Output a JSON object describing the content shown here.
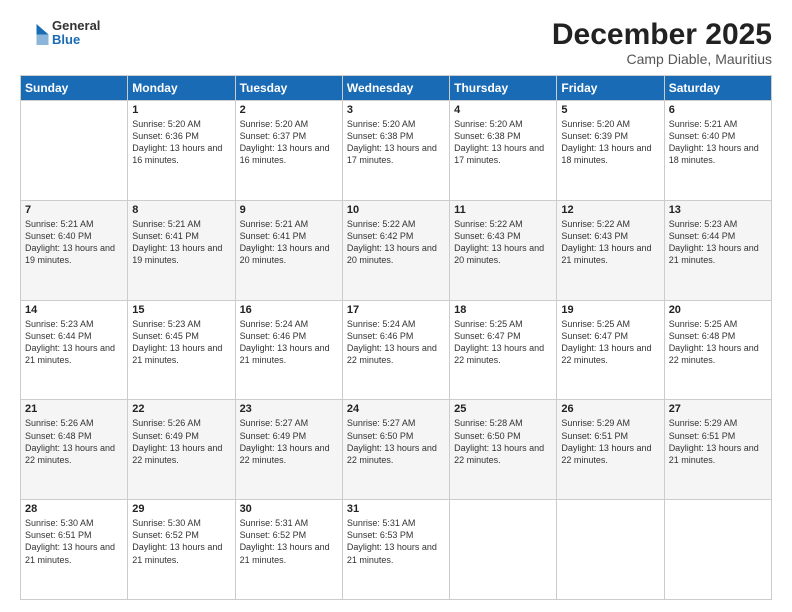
{
  "header": {
    "logo_general": "General",
    "logo_blue": "Blue",
    "title": "December 2025",
    "location": "Camp Diable, Mauritius"
  },
  "days_of_week": [
    "Sunday",
    "Monday",
    "Tuesday",
    "Wednesday",
    "Thursday",
    "Friday",
    "Saturday"
  ],
  "weeks": [
    [
      {
        "day": "",
        "info": ""
      },
      {
        "day": "1",
        "info": "Sunrise: 5:20 AM\nSunset: 6:36 PM\nDaylight: 13 hours and 16 minutes."
      },
      {
        "day": "2",
        "info": "Sunrise: 5:20 AM\nSunset: 6:37 PM\nDaylight: 13 hours and 16 minutes."
      },
      {
        "day": "3",
        "info": "Sunrise: 5:20 AM\nSunset: 6:38 PM\nDaylight: 13 hours and 17 minutes."
      },
      {
        "day": "4",
        "info": "Sunrise: 5:20 AM\nSunset: 6:38 PM\nDaylight: 13 hours and 17 minutes."
      },
      {
        "day": "5",
        "info": "Sunrise: 5:20 AM\nSunset: 6:39 PM\nDaylight: 13 hours and 18 minutes."
      },
      {
        "day": "6",
        "info": "Sunrise: 5:21 AM\nSunset: 6:40 PM\nDaylight: 13 hours and 18 minutes."
      }
    ],
    [
      {
        "day": "7",
        "info": "Sunrise: 5:21 AM\nSunset: 6:40 PM\nDaylight: 13 hours and 19 minutes."
      },
      {
        "day": "8",
        "info": "Sunrise: 5:21 AM\nSunset: 6:41 PM\nDaylight: 13 hours and 19 minutes."
      },
      {
        "day": "9",
        "info": "Sunrise: 5:21 AM\nSunset: 6:41 PM\nDaylight: 13 hours and 20 minutes."
      },
      {
        "day": "10",
        "info": "Sunrise: 5:22 AM\nSunset: 6:42 PM\nDaylight: 13 hours and 20 minutes."
      },
      {
        "day": "11",
        "info": "Sunrise: 5:22 AM\nSunset: 6:43 PM\nDaylight: 13 hours and 20 minutes."
      },
      {
        "day": "12",
        "info": "Sunrise: 5:22 AM\nSunset: 6:43 PM\nDaylight: 13 hours and 21 minutes."
      },
      {
        "day": "13",
        "info": "Sunrise: 5:23 AM\nSunset: 6:44 PM\nDaylight: 13 hours and 21 minutes."
      }
    ],
    [
      {
        "day": "14",
        "info": "Sunrise: 5:23 AM\nSunset: 6:44 PM\nDaylight: 13 hours and 21 minutes."
      },
      {
        "day": "15",
        "info": "Sunrise: 5:23 AM\nSunset: 6:45 PM\nDaylight: 13 hours and 21 minutes."
      },
      {
        "day": "16",
        "info": "Sunrise: 5:24 AM\nSunset: 6:46 PM\nDaylight: 13 hours and 21 minutes."
      },
      {
        "day": "17",
        "info": "Sunrise: 5:24 AM\nSunset: 6:46 PM\nDaylight: 13 hours and 22 minutes."
      },
      {
        "day": "18",
        "info": "Sunrise: 5:25 AM\nSunset: 6:47 PM\nDaylight: 13 hours and 22 minutes."
      },
      {
        "day": "19",
        "info": "Sunrise: 5:25 AM\nSunset: 6:47 PM\nDaylight: 13 hours and 22 minutes."
      },
      {
        "day": "20",
        "info": "Sunrise: 5:25 AM\nSunset: 6:48 PM\nDaylight: 13 hours and 22 minutes."
      }
    ],
    [
      {
        "day": "21",
        "info": "Sunrise: 5:26 AM\nSunset: 6:48 PM\nDaylight: 13 hours and 22 minutes."
      },
      {
        "day": "22",
        "info": "Sunrise: 5:26 AM\nSunset: 6:49 PM\nDaylight: 13 hours and 22 minutes."
      },
      {
        "day": "23",
        "info": "Sunrise: 5:27 AM\nSunset: 6:49 PM\nDaylight: 13 hours and 22 minutes."
      },
      {
        "day": "24",
        "info": "Sunrise: 5:27 AM\nSunset: 6:50 PM\nDaylight: 13 hours and 22 minutes."
      },
      {
        "day": "25",
        "info": "Sunrise: 5:28 AM\nSunset: 6:50 PM\nDaylight: 13 hours and 22 minutes."
      },
      {
        "day": "26",
        "info": "Sunrise: 5:29 AM\nSunset: 6:51 PM\nDaylight: 13 hours and 22 minutes."
      },
      {
        "day": "27",
        "info": "Sunrise: 5:29 AM\nSunset: 6:51 PM\nDaylight: 13 hours and 21 minutes."
      }
    ],
    [
      {
        "day": "28",
        "info": "Sunrise: 5:30 AM\nSunset: 6:51 PM\nDaylight: 13 hours and 21 minutes."
      },
      {
        "day": "29",
        "info": "Sunrise: 5:30 AM\nSunset: 6:52 PM\nDaylight: 13 hours and 21 minutes."
      },
      {
        "day": "30",
        "info": "Sunrise: 5:31 AM\nSunset: 6:52 PM\nDaylight: 13 hours and 21 minutes."
      },
      {
        "day": "31",
        "info": "Sunrise: 5:31 AM\nSunset: 6:53 PM\nDaylight: 13 hours and 21 minutes."
      },
      {
        "day": "",
        "info": ""
      },
      {
        "day": "",
        "info": ""
      },
      {
        "day": "",
        "info": ""
      }
    ]
  ]
}
